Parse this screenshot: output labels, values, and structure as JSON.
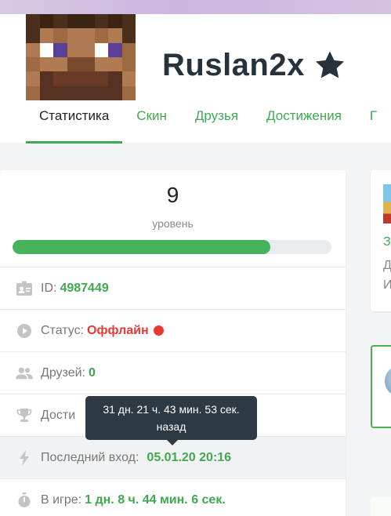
{
  "profile": {
    "username": "Ruslan2x",
    "avatar_icon": "minecraft-skin-face",
    "star_icon": "star-icon"
  },
  "tabs": [
    {
      "label": "Статистика",
      "active": true
    },
    {
      "label": "Скин",
      "active": false
    },
    {
      "label": "Друзья",
      "active": false
    },
    {
      "label": "Достижения",
      "active": false
    },
    {
      "label": "Г",
      "active": false
    }
  ],
  "level": {
    "value": "9",
    "label": "уровень",
    "progress_percent": 80.8
  },
  "stats": {
    "id": {
      "label": "ID:",
      "value": "4987449"
    },
    "status": {
      "label": "Статус:",
      "value": "Оффлайн"
    },
    "friends": {
      "label": "Друзей:",
      "value": "0"
    },
    "achievements": {
      "label": "Дости"
    },
    "last_login": {
      "label": "Последний вход:",
      "value": "05.01.20 20:16"
    },
    "playtime": {
      "label": "В игре:",
      "value": "1 дн. 8 ч. 44 мин. 6 сек."
    }
  },
  "tooltip": {
    "line1": "31 дн. 21 ч. 43 мин. 53 сек.",
    "line2": "назад"
  },
  "right_peek": {
    "letter1": "З",
    "letter2": "Д",
    "letter3": "И"
  },
  "colors": {
    "accent_green": "#3fa950",
    "status_red": "#e63a32",
    "tooltip_bg": "#2d3a44",
    "username": "#26333d"
  }
}
